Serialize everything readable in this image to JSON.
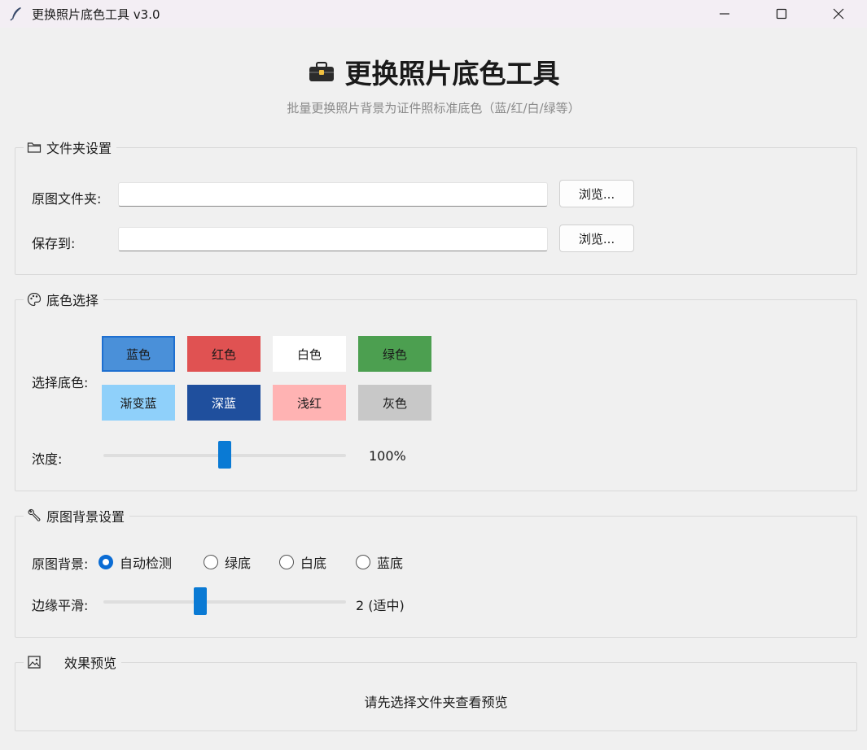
{
  "window": {
    "title": "更换照片底色工具 v3.0"
  },
  "header": {
    "title": "更换照片底色工具",
    "subtitle": "批量更换照片背景为证件照标准底色（蓝/红/白/绿等）"
  },
  "folder_settings": {
    "legend": "文件夹设置",
    "source_label": "原图文件夹:",
    "source_value": "",
    "save_label": "保存到:",
    "save_value": "",
    "browse_label": "浏览..."
  },
  "color_select": {
    "legend": "底色选择",
    "label": "选择底色:",
    "colors": [
      {
        "label": "蓝色",
        "bg": "#4a90d9",
        "fg": "#1a1a1a",
        "selected": true
      },
      {
        "label": "红色",
        "bg": "#e05252",
        "fg": "#1a1a1a",
        "selected": false
      },
      {
        "label": "白色",
        "bg": "#ffffff",
        "fg": "#1a1a1a",
        "selected": false
      },
      {
        "label": "绿色",
        "bg": "#4c9f50",
        "fg": "#1a1a1a",
        "selected": false
      },
      {
        "label": "渐变蓝",
        "bg": "#8fd0fa",
        "fg": "#1a1a1a",
        "selected": false
      },
      {
        "label": "深蓝",
        "bg": "#1f4f9d",
        "fg": "#ffffff",
        "selected": false
      },
      {
        "label": "浅红",
        "bg": "#ffb3b3",
        "fg": "#1a1a1a",
        "selected": false
      },
      {
        "label": "灰色",
        "bg": "#c8c8c8",
        "fg": "#1a1a1a",
        "selected": false
      }
    ],
    "intensity_label": "浓度:",
    "intensity_value": "100%",
    "intensity_fraction": 0.5
  },
  "background_settings": {
    "legend": "原图背景设置",
    "label": "原图背景:",
    "options": [
      {
        "label": "自动检测",
        "checked": true
      },
      {
        "label": "绿底",
        "checked": false
      },
      {
        "label": "白底",
        "checked": false
      },
      {
        "label": "蓝底",
        "checked": false
      }
    ],
    "smooth_label": "边缘平滑:",
    "smooth_value": "2 (适中)",
    "smooth_fraction": 0.4
  },
  "preview": {
    "legend": "效果预览",
    "message": "请先选择文件夹查看预览"
  }
}
